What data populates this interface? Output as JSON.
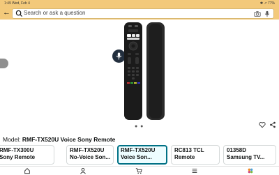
{
  "status_bar": {
    "time": "1:49  Wed, Feb 4",
    "right": "✱ ↗ 77%"
  },
  "search": {
    "placeholder": "Search or ask a question"
  },
  "carousel": {
    "dots": "● ●"
  },
  "model": {
    "label": "Model:",
    "value": "RMF-TX520U Voice Sony Remote"
  },
  "variants": [
    {
      "line1": "RMF-TX300U",
      "line2": "Sony Remote",
      "selected": false
    },
    {
      "line1": "RMF-TX520U",
      "line2": "No-Voice Son...",
      "selected": false
    },
    {
      "line1": "RMF-TX520U",
      "line2": "Voice Son...",
      "selected": true
    },
    {
      "line1": "RC813 TCL",
      "line2": "Remote",
      "selected": false
    },
    {
      "line1": "01358D",
      "line2": "Samsung TV...",
      "selected": false
    }
  ],
  "icons": {
    "back": "back-arrow-icon",
    "search": "search-icon",
    "camera": "camera-icon",
    "mic": "microphone-icon",
    "heart": "heart-icon",
    "share": "share-icon",
    "nav": [
      "home-icon",
      "profile-icon",
      "cart-icon",
      "menu-icon",
      "assistant-icon"
    ]
  },
  "colors": {
    "header": "#f3c97a",
    "selected_border": "#007185",
    "fab": "#232f3e"
  }
}
